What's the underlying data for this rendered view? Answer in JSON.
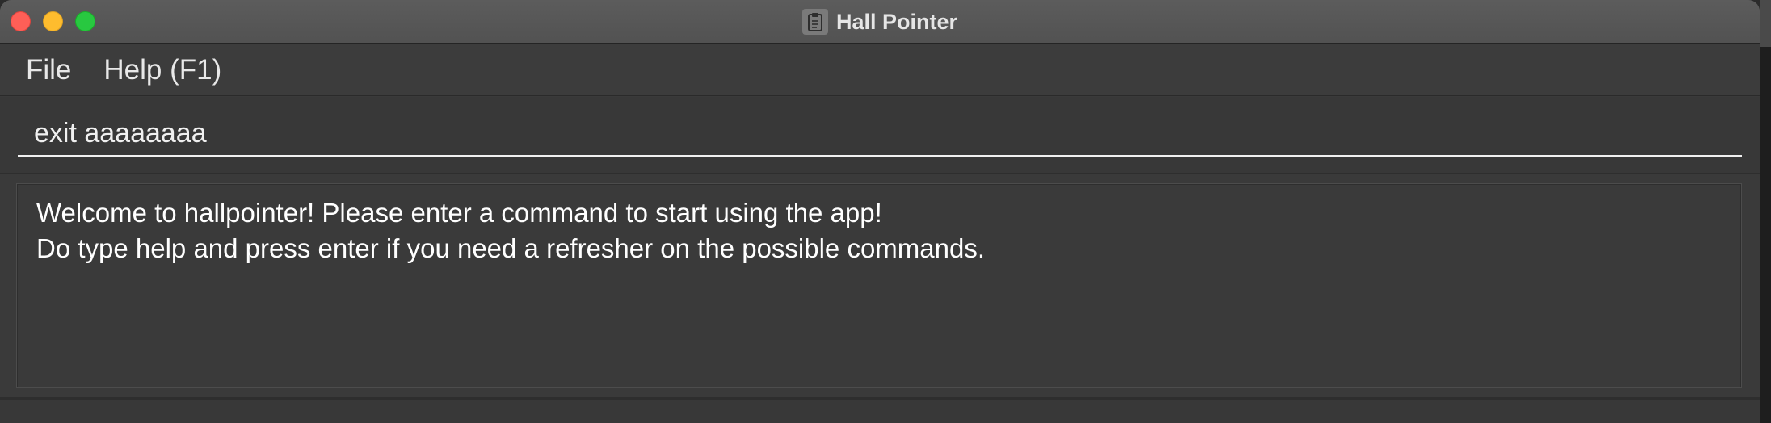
{
  "window": {
    "title": "Hall Pointer",
    "app_icon": "clipboard-icon",
    "traffic_lights": {
      "close_color": "#fe5f57",
      "minimize_color": "#febc2e",
      "maximize_color": "#28c840"
    }
  },
  "menu": {
    "items": [
      {
        "label": "File"
      },
      {
        "label": "Help (F1)"
      }
    ]
  },
  "command_box": {
    "value": "exit aaaaaaaa"
  },
  "result_display": {
    "lines": [
      "Welcome to hallpointer! Please enter a command to start using the app!",
      "Do type help and press enter if you need a refresher on the possible commands."
    ]
  }
}
